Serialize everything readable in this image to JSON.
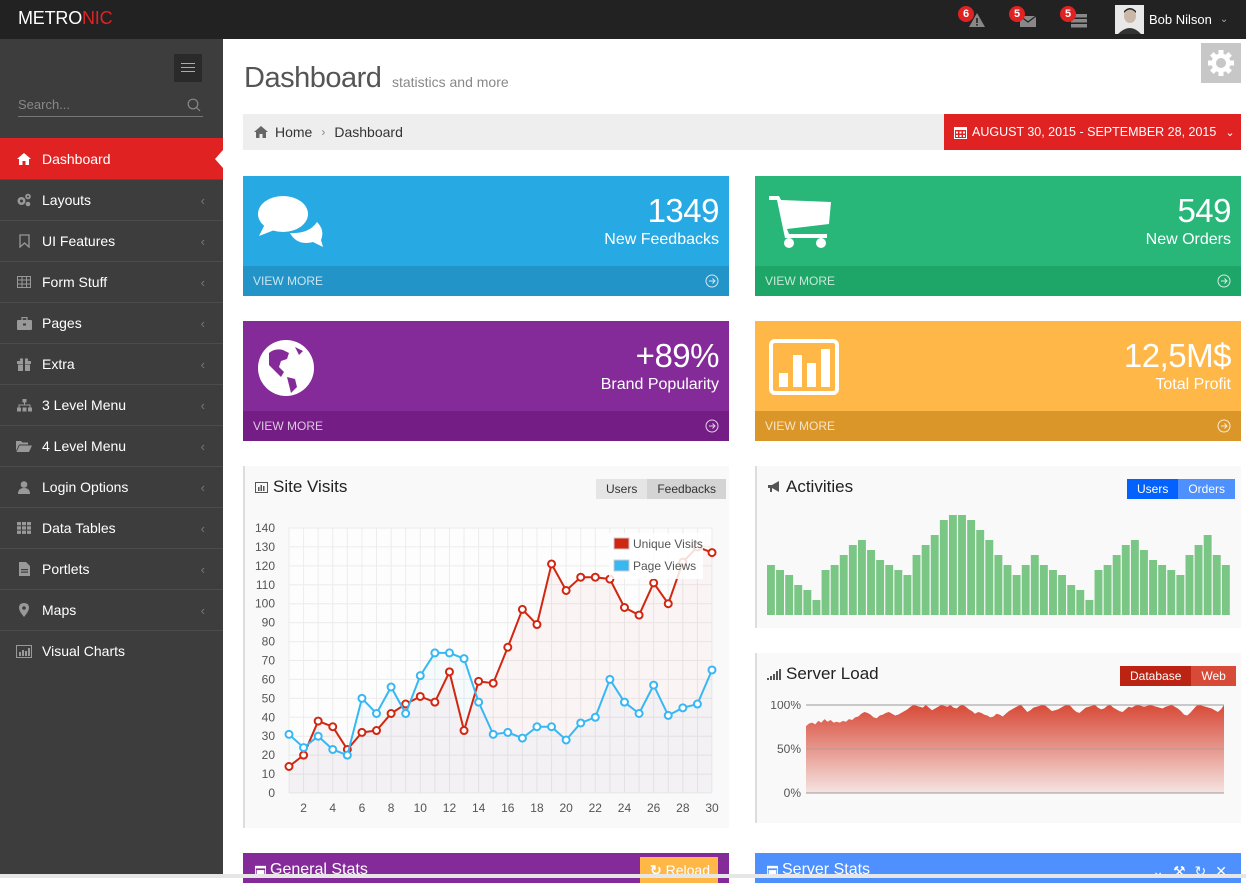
{
  "topbar": {
    "logo_main": "METRO",
    "logo_accent": "NIC",
    "notifications": [
      {
        "icon": "warning-icon",
        "count": "6"
      },
      {
        "icon": "envelope-icon",
        "count": "5"
      },
      {
        "icon": "tasks-icon",
        "count": "5"
      }
    ],
    "user_name": "Bob Nilson"
  },
  "sidebar": {
    "search_placeholder": "Search...",
    "items": [
      {
        "label": "Dashboard",
        "icon": "home-icon",
        "active": true
      },
      {
        "label": "Layouts",
        "icon": "cogs-icon"
      },
      {
        "label": "UI Features",
        "icon": "bookmark-icon"
      },
      {
        "label": "Form Stuff",
        "icon": "table-icon"
      },
      {
        "label": "Pages",
        "icon": "briefcase-icon"
      },
      {
        "label": "Extra",
        "icon": "gift-icon"
      },
      {
        "label": "3 Level Menu",
        "icon": "sitemap-icon"
      },
      {
        "label": "4 Level Menu",
        "icon": "folder-open-icon"
      },
      {
        "label": "Login Options",
        "icon": "user-icon"
      },
      {
        "label": "Data Tables",
        "icon": "th-icon"
      },
      {
        "label": "Portlets",
        "icon": "file-icon"
      },
      {
        "label": "Maps",
        "icon": "map-marker-icon"
      },
      {
        "label": "Visual Charts",
        "icon": "bar-chart-icon"
      }
    ]
  },
  "page": {
    "title": "Dashboard",
    "subtitle": "statistics and more",
    "breadcrumb": [
      "Home",
      "Dashboard"
    ],
    "date_range": "AUGUST 30, 2015 - SEPTEMBER 28, 2015"
  },
  "stats": [
    {
      "value": "1349",
      "label": "New Feedbacks",
      "more": "VIEW MORE",
      "color": "#27a9e3",
      "footer_color": "#2394c7",
      "icon": "comments-icon"
    },
    {
      "value": "549",
      "label": "New Orders",
      "more": "VIEW MORE",
      "color": "#28b779",
      "footer_color": "#1da667",
      "icon": "shopping-cart-icon"
    },
    {
      "value": "+89%",
      "label": "Brand Popularity",
      "more": "VIEW MORE",
      "color": "#852b99",
      "footer_color": "#731d85",
      "icon": "globe-icon"
    },
    {
      "value": "12,5M$",
      "label": "Total Profit",
      "more": "VIEW MORE",
      "color": "#ffb848",
      "footer_color": "#db9629",
      "icon": "bar-chart-icon"
    }
  ],
  "site_visits": {
    "title": "Site Visits",
    "buttons": [
      "Users",
      "Feedbacks"
    ]
  },
  "activities": {
    "title": "Activities",
    "buttons": [
      "Users",
      "Orders"
    ]
  },
  "server_load": {
    "title": "Server Load",
    "buttons": [
      "Database",
      "Web"
    ]
  },
  "bottom": {
    "general_stats": "General Stats",
    "reload": "Reload",
    "server_stats": "Server Stats"
  },
  "chart_data": [
    {
      "type": "line",
      "title": "Site Visits",
      "x": [
        1,
        2,
        3,
        4,
        5,
        6,
        7,
        8,
        9,
        10,
        11,
        12,
        13,
        14,
        15,
        16,
        17,
        18,
        19,
        20,
        21,
        22,
        23,
        24,
        25,
        26,
        27,
        28,
        29,
        30
      ],
      "x_ticks": [
        2,
        4,
        6,
        8,
        10,
        12,
        14,
        16,
        18,
        20,
        22,
        24,
        26,
        28,
        30
      ],
      "ylim": [
        0,
        140
      ],
      "y_ticks": [
        0,
        10,
        20,
        30,
        40,
        50,
        60,
        70,
        80,
        90,
        100,
        110,
        120,
        130,
        140
      ],
      "grid": true,
      "legend": "top-right",
      "series": [
        {
          "name": "Unique Visits",
          "color": "#d12610",
          "values": [
            14,
            20,
            38,
            35,
            23,
            32,
            33,
            42,
            47,
            51,
            48,
            64,
            33,
            59,
            58,
            77,
            97,
            89,
            121,
            107,
            114,
            114,
            113,
            98,
            94,
            111,
            100,
            122,
            130,
            127
          ]
        },
        {
          "name": "Page Views",
          "color": "#37b7f3",
          "values": [
            31,
            24,
            30,
            23,
            20,
            50,
            42,
            56,
            42,
            62,
            74,
            74,
            71,
            48,
            31,
            32,
            29,
            35,
            35,
            28,
            37,
            40,
            60,
            48,
            42,
            57,
            41,
            45,
            47,
            65
          ]
        }
      ]
    },
    {
      "type": "bar",
      "title": "Activities",
      "color": "#35aa47",
      "values": [
        10,
        9,
        8,
        6,
        5,
        3,
        9,
        10,
        12,
        14,
        15,
        13,
        11,
        10,
        9,
        8,
        12,
        14,
        16,
        19,
        20,
        20,
        19,
        17,
        15,
        12,
        10,
        8,
        10,
        12,
        10,
        9,
        8,
        6,
        5,
        3,
        9,
        10,
        12,
        14,
        15,
        13,
        11,
        10,
        9,
        8,
        12,
        14,
        16,
        12,
        10
      ],
      "ylim": [
        0,
        20
      ]
    },
    {
      "type": "area",
      "title": "Server Load",
      "color": "#d84a38",
      "ylim": [
        0,
        100
      ],
      "y_ticks": [
        "0%",
        "50%",
        "100%"
      ],
      "values": [
        76,
        79,
        80,
        78,
        82,
        80,
        84,
        81,
        83,
        80,
        81,
        80,
        82,
        81,
        84,
        83,
        86,
        87,
        90,
        92,
        91,
        89,
        86,
        85,
        88,
        89,
        91,
        92,
        90,
        88,
        89,
        91,
        93,
        95,
        98,
        100,
        99,
        98,
        97,
        100,
        97,
        94,
        96,
        98,
        100,
        99,
        98,
        100,
        97,
        96,
        99,
        100,
        98,
        95,
        93,
        90,
        92,
        91,
        89,
        88,
        86,
        87,
        90,
        89,
        87,
        90,
        93,
        95,
        97,
        99,
        100,
        96,
        92,
        94,
        97,
        98,
        99,
        100,
        99,
        96,
        93,
        94,
        95,
        97,
        99,
        100,
        99,
        95,
        92,
        91,
        94,
        97,
        98,
        99,
        100,
        97,
        95,
        96,
        99,
        100,
        97,
        95,
        93,
        92,
        95,
        98,
        97,
        99,
        100,
        99,
        98,
        99,
        100,
        99,
        98,
        97,
        96,
        98,
        99,
        100,
        98,
        96,
        93,
        89,
        88,
        91,
        95,
        99,
        100,
        99,
        98,
        97,
        96,
        94,
        92,
        95,
        100
      ]
    }
  ]
}
